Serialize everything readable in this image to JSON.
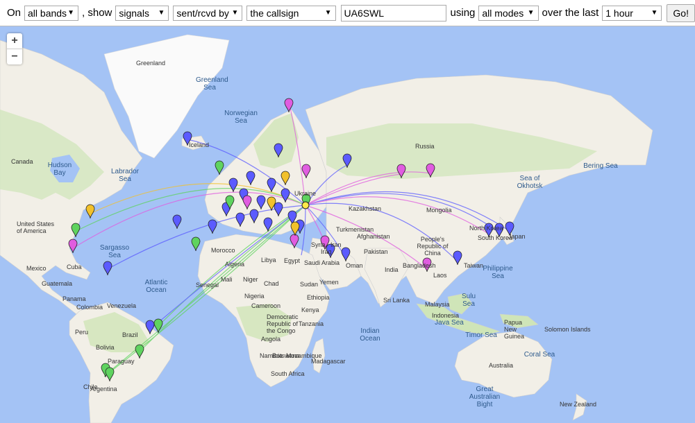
{
  "toolbar": {
    "on_label": "On",
    "band_value": "all bands",
    "show_label": ", show",
    "type_value": "signals",
    "direction_value": "sent/rcvd by",
    "who_value": "the callsign",
    "callsign_value": "UA6SWL",
    "using_label": "using",
    "mode_value": "all modes",
    "period_label": "over the last",
    "period_value": "1 hour",
    "go_label": "Go!"
  },
  "map": {
    "zoom_in": "+",
    "zoom_out": "−",
    "labels": {
      "greenland": "Greenland",
      "greenland_sea": "Greenland Sea",
      "norwegian_sea": "Norwegian Sea",
      "iceland": "Iceland",
      "canada": "Canada",
      "hudson_bay": "Hudson Bay",
      "labrador_sea": "Labrador Sea",
      "usa": "United States of America",
      "mexico": "Mexico",
      "cuba": "Cuba",
      "guatemala": "Guatemala",
      "panama": "Panama",
      "sargasso_sea": "Sargasso Sea",
      "atlantic_ocean": "Atlantic Ocean",
      "colombia": "Colombia",
      "venezuela": "Venezuela",
      "peru": "Peru",
      "brazil": "Brazil",
      "bolivia": "Bolivia",
      "paraguay": "Paraguay",
      "chile": "Chile",
      "argentina": "Argentina",
      "morocco": "Morocco",
      "algeria": "Algeria",
      "libya": "Libya",
      "egypt": "Egypt",
      "mali": "Mali",
      "niger": "Niger",
      "chad": "Chad",
      "sudan": "Sudan",
      "nigeria": "Nigeria",
      "ethiopia": "Ethiopia",
      "cameroon": "Cameroon",
      "kenya": "Kenya",
      "drc": "Democratic Republic of the Congo",
      "tanzania": "Tanzania",
      "angola": "Angola",
      "namibia": "Namibia",
      "mozambique": "Mozambique",
      "botswana": "Botswana",
      "south_africa": "South Africa",
      "madagascar": "Madagascar",
      "senegal": "Senegal",
      "russia": "Russia",
      "kazakhstan": "Kazakhstan",
      "turkmenistan": "Turkmenistan",
      "mongolia": "Mongolia",
      "china": "People's Republic of China",
      "iran": "Iran",
      "afghanistan": "Afghanistan",
      "pakistan": "Pakistan",
      "syria": "Syria",
      "iraq": "Iraq",
      "saudi_arabia": "Saudi Arabia",
      "yemen": "Yemen",
      "oman": "Oman",
      "india": "India",
      "bangladesh": "Bangladesh",
      "laos": "Laos",
      "sri_lanka": "Sri Lanka",
      "malaysia": "Malaysia",
      "indonesia": "Indonesia",
      "java_sea": "Java Sea",
      "sulu_sea": "Sulu Sea",
      "philippine_sea": "Philippine Sea",
      "taiwan": "Taiwan",
      "north_korea": "North Korea",
      "south_korea": "South Korea",
      "japan": "Japan",
      "sea_of_okhotsk": "Sea of Okhotsk",
      "bering_sea": "Bering Sea",
      "indian_ocean": "Indian Ocean",
      "timor_sea": "Timor Sea",
      "coral_sea": "Coral Sea",
      "papua_new_guinea": "Papua New Guinea",
      "solomon_islands": "Solomon Islands",
      "australia": "Australia",
      "great_australian_bight": "Great Australian Bight",
      "new_zealand": "New Zealand",
      "ukraine": "Ukraine"
    },
    "colors": {
      "ocean": "#a4c3f5",
      "land": "#f2efe7",
      "green_land": "#cfe5b8",
      "ice": "#fafafa",
      "pin_blue": "#5b5bff",
      "pin_magenta": "#e05ce0",
      "pin_green": "#5fd35f",
      "pin_yellow": "#f2c12b"
    }
  }
}
